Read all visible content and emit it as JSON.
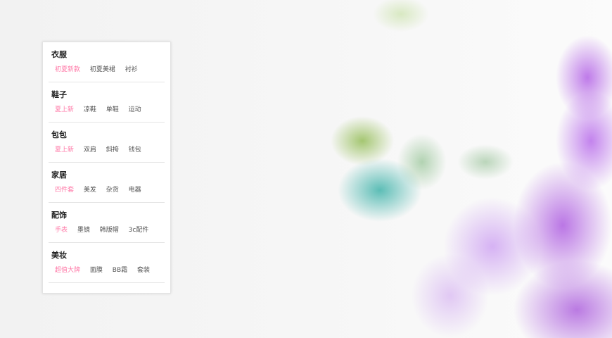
{
  "accent_color": "#ff7aa8",
  "categories": [
    {
      "title": "衣服",
      "tags": [
        "初夏新款",
        "初夏美裙",
        "衬衫"
      ]
    },
    {
      "title": "鞋子",
      "tags": [
        "夏上新",
        "凉鞋",
        "单鞋",
        "运动"
      ]
    },
    {
      "title": "包包",
      "tags": [
        "夏上新",
        "双肩",
        "斜挎",
        "钱包"
      ]
    },
    {
      "title": "家居",
      "tags": [
        "四件套",
        "美发",
        "杂货",
        "电器"
      ]
    },
    {
      "title": "配饰",
      "tags": [
        "手表",
        "墨镜",
        "韩版帽",
        "3c配件"
      ]
    },
    {
      "title": "美妆",
      "tags": [
        "超值大牌",
        "面膜",
        "BB霜",
        "套装"
      ]
    }
  ]
}
